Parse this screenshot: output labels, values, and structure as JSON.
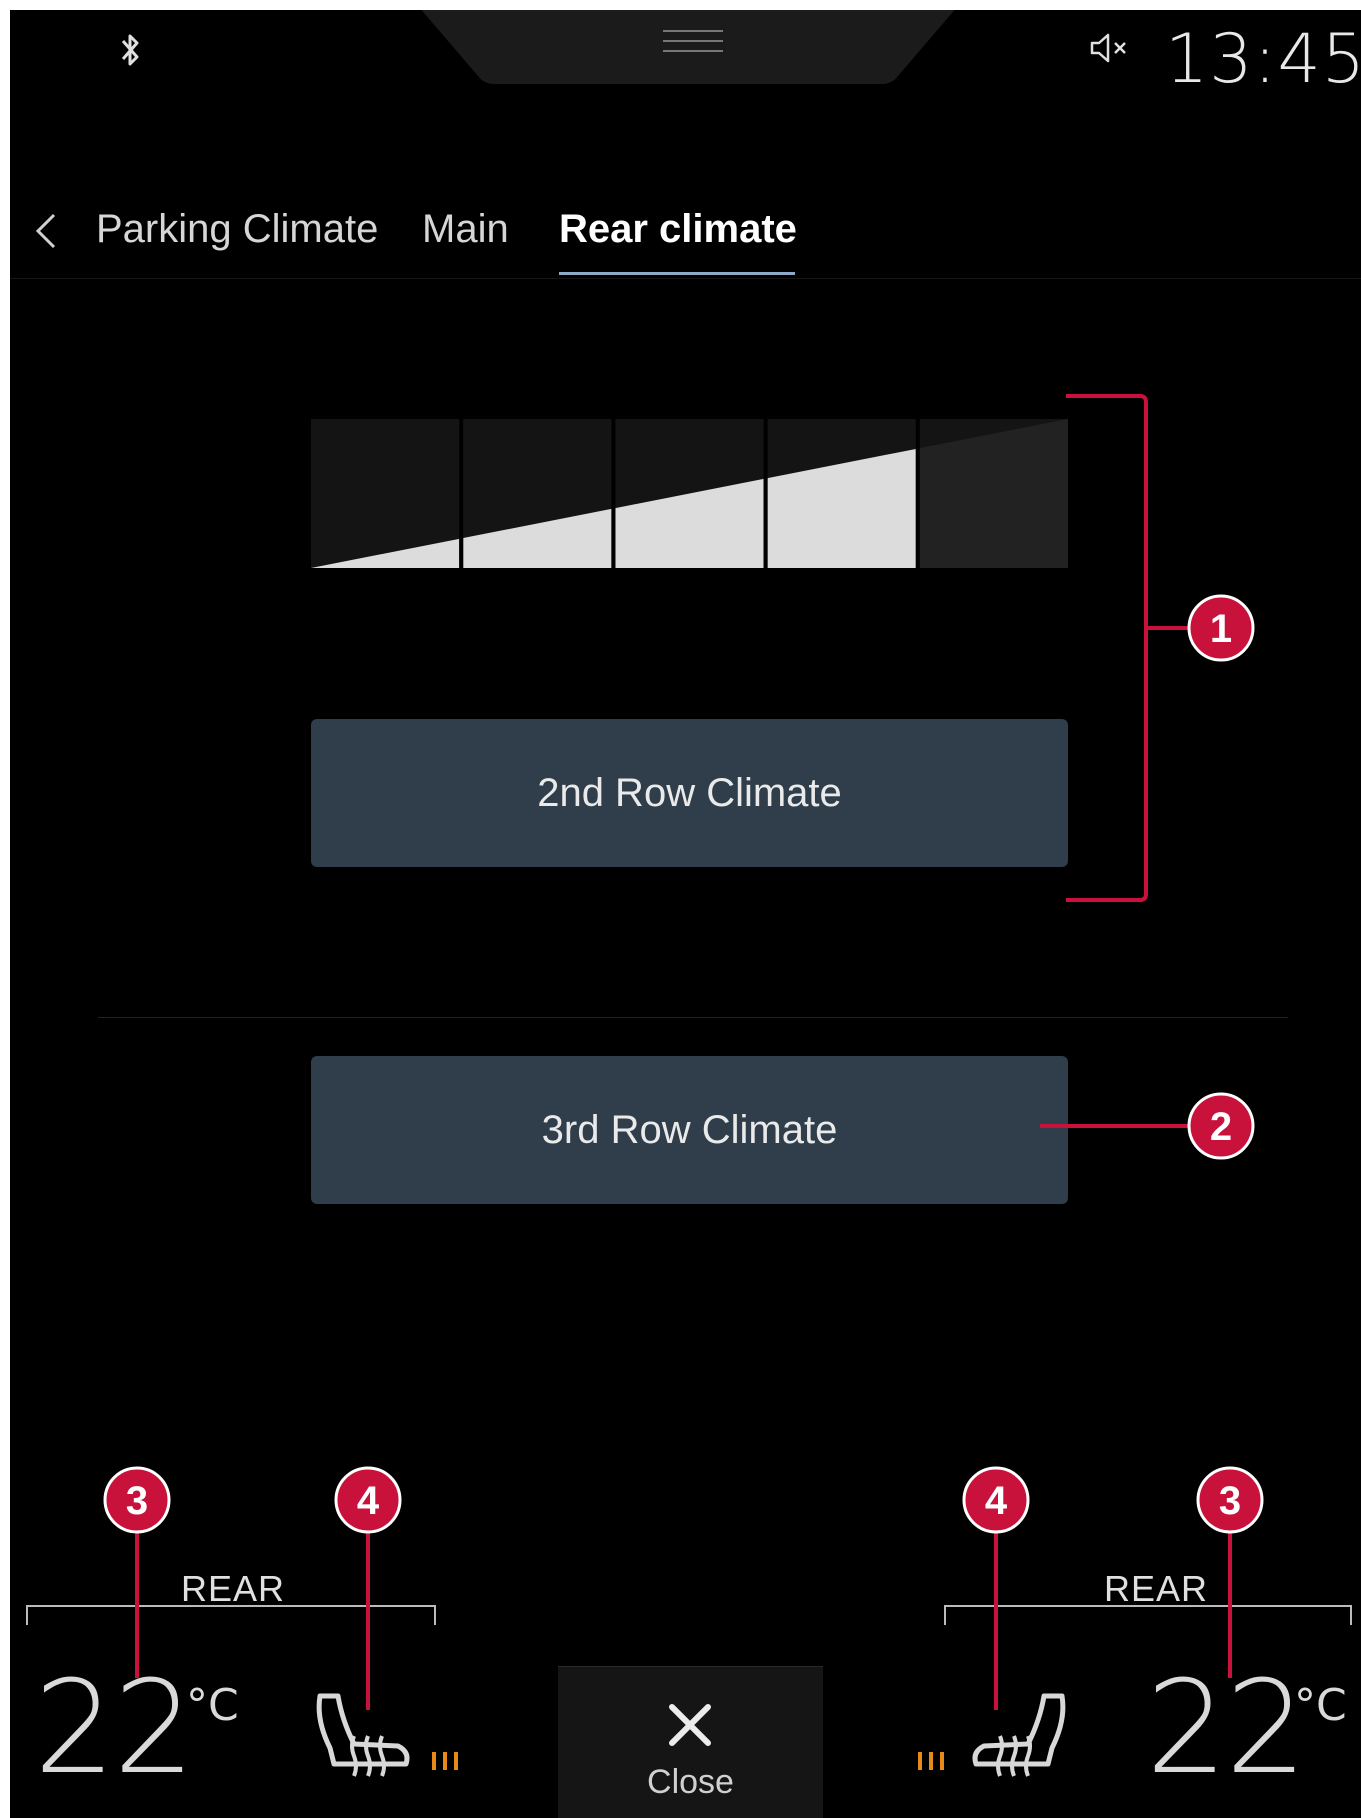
{
  "status_bar": {
    "clock": "13:45",
    "icons": [
      "bluetooth-icon",
      "mute-icon"
    ]
  },
  "tabs": {
    "items": [
      {
        "label": "Parking Climate"
      },
      {
        "label": "Main"
      },
      {
        "label": "Rear climate",
        "active": true
      }
    ]
  },
  "fan": {
    "segments_total": 5,
    "level": 4
  },
  "buttons": {
    "second_row": "2nd Row Climate",
    "third_row": "3rd Row Climate"
  },
  "bottom_bar": {
    "left": {
      "zone": "REAR",
      "temperature": "22",
      "unit": "°C",
      "seat_heat_level": 3
    },
    "right": {
      "zone": "REAR",
      "temperature": "22",
      "unit": "°C",
      "seat_heat_level": 3
    },
    "close_label": "Close"
  },
  "callouts": [
    "1",
    "2",
    "3",
    "4",
    "4",
    "3"
  ],
  "colors": {
    "background": "#000000",
    "button": "#2f3e4a",
    "accent_underline": "#8fa9c8",
    "callout": "#c8123b",
    "heat_indicator": "#e8891a"
  }
}
